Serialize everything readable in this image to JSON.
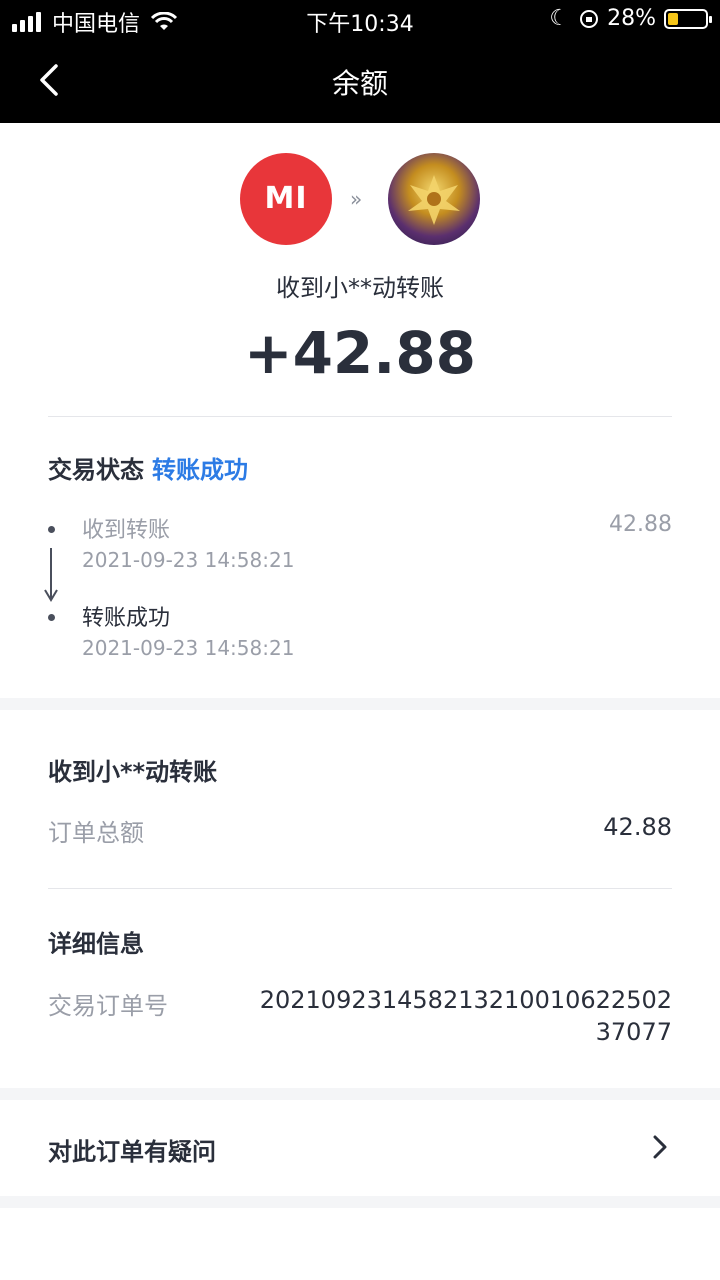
{
  "status_bar": {
    "carrier": "中国电信",
    "time": "下午10:34",
    "battery": "28%",
    "battery_level": 0.28
  },
  "nav": {
    "title": "余额"
  },
  "hero": {
    "sender_logo_text": "MI",
    "subtitle": "收到小**动转账",
    "amount": "+42.88"
  },
  "transaction": {
    "status_label": "交易状态",
    "status_value": "转账成功",
    "steps": [
      {
        "label": "收到转账",
        "time": "2021-09-23 14:58:21",
        "value": "42.88"
      },
      {
        "label": "转账成功",
        "time": "2021-09-23 14:58:21"
      }
    ]
  },
  "order": {
    "title": "收到小**动转账",
    "total_label": "订单总额",
    "total_value": "42.88",
    "detail_title": "详细信息",
    "order_no_label": "交易订单号",
    "order_no_value": "2021092314582132100106225 0237077"
  },
  "faq": {
    "label": "对此订单有疑问"
  },
  "colors": {
    "accent": "#2c7be5",
    "mi_red": "#e8363a",
    "text": "#2a2f3b",
    "muted": "#9a9ea8"
  }
}
